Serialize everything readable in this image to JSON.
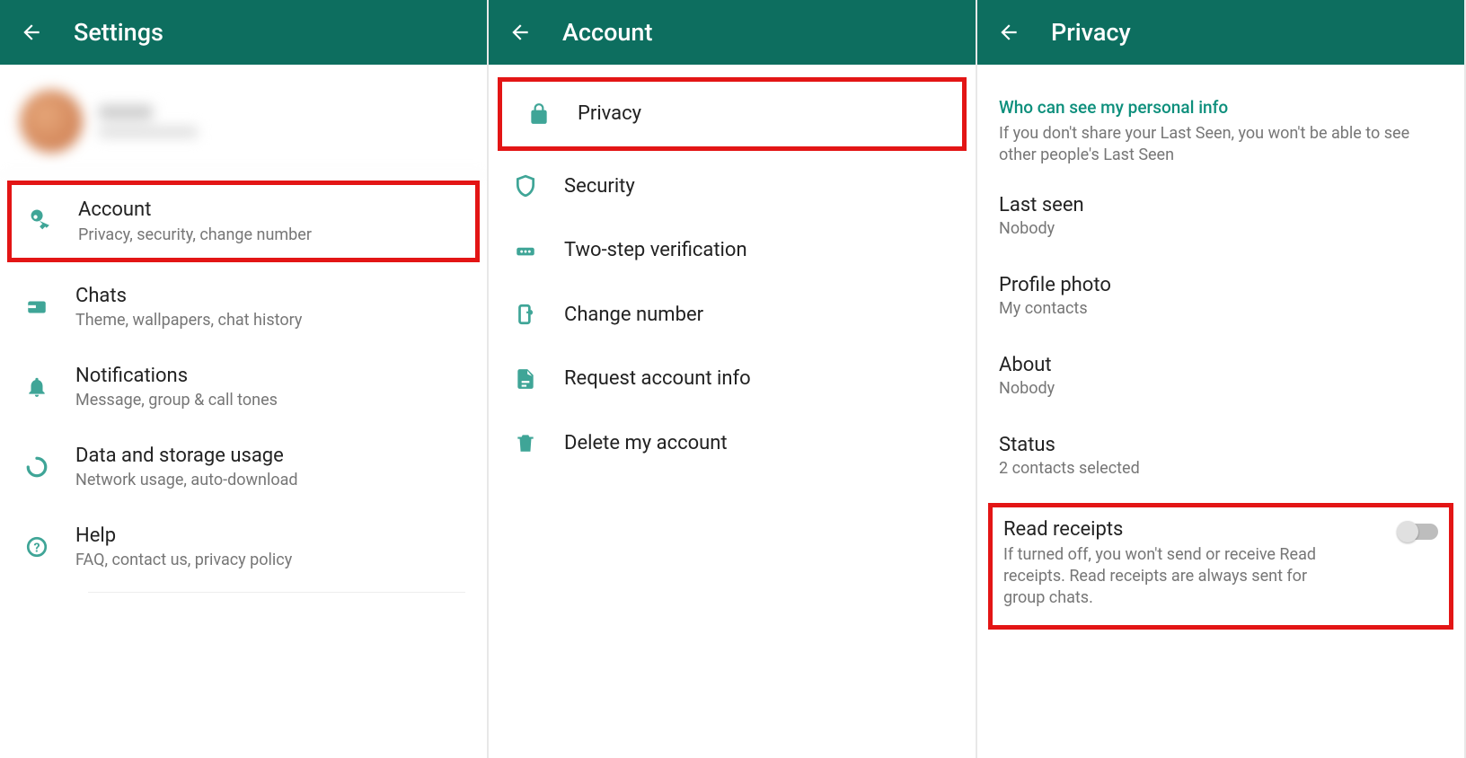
{
  "panel1": {
    "title": "Settings",
    "items": {
      "account": {
        "title": "Account",
        "sub": "Privacy, security, change number"
      },
      "chats": {
        "title": "Chats",
        "sub": "Theme, wallpapers, chat history"
      },
      "notifications": {
        "title": "Notifications",
        "sub": "Message, group & call tones"
      },
      "data": {
        "title": "Data and storage usage",
        "sub": "Network usage, auto-download"
      },
      "help": {
        "title": "Help",
        "sub": "FAQ, contact us, privacy policy"
      }
    }
  },
  "panel2": {
    "title": "Account",
    "items": {
      "privacy": "Privacy",
      "security": "Security",
      "twostep": "Two-step verification",
      "changenumber": "Change number",
      "requestinfo": "Request account info",
      "delete": "Delete my account"
    }
  },
  "panel3": {
    "title": "Privacy",
    "sectionHeader": "Who can see my personal info",
    "sectionSub": "If you don't share your Last Seen, you won't be able to see other people's Last Seen",
    "lastSeen": {
      "title": "Last seen",
      "value": "Nobody"
    },
    "profilePhoto": {
      "title": "Profile photo",
      "value": "My contacts"
    },
    "about": {
      "title": "About",
      "value": "Nobody"
    },
    "status": {
      "title": "Status",
      "value": "2 contacts selected"
    },
    "readReceipts": {
      "title": "Read receipts",
      "sub": "If turned off, you won't send or receive Read receipts. Read receipts are always sent for group chats."
    }
  }
}
